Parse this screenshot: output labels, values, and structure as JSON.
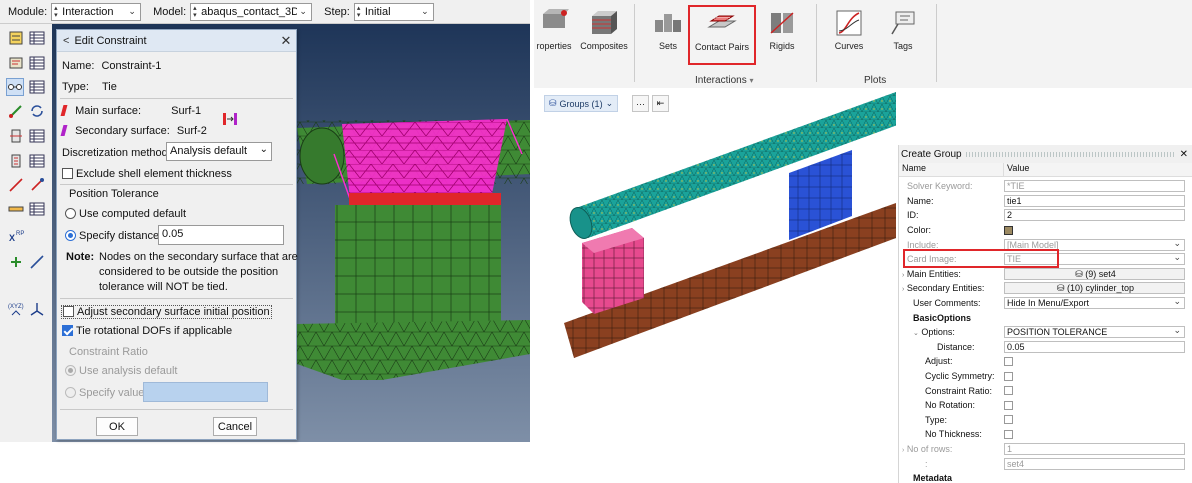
{
  "abaqus": {
    "module_label": "Module:",
    "module_value": "Interaction",
    "model_label": "Model:",
    "model_value": "abaqus_contact_3D",
    "step_label": "Step:",
    "step_value": "Initial"
  },
  "dialog": {
    "title": "Edit Constraint",
    "name_label": "Name:",
    "name_value": "Constraint-1",
    "type_label": "Type:",
    "type_value": "Tie",
    "main_surface_label": "Main surface:",
    "main_surface_value": "Surf-1",
    "secondary_surface_label": "Secondary surface:",
    "secondary_surface_value": "Surf-2",
    "discretization_label": "Discretization method:",
    "discretization_value": "Analysis default",
    "exclude_shell_label": "Exclude shell element thickness",
    "exclude_shell_checked": false,
    "position_tolerance_title": "Position Tolerance",
    "use_computed_default_label": "Use computed default",
    "specify_distance_label": "Specify distance:",
    "specify_distance_value": "0.05",
    "note_label": "Note:",
    "note_line1": "Nodes on the secondary surface that are",
    "note_line2": "considered to be outside the position",
    "note_line3": "tolerance will NOT be tied.",
    "adjust_label": "Adjust secondary surface initial position",
    "adjust_checked": false,
    "tie_rot_label": "Tie rotational DOFs if applicable",
    "tie_rot_checked": true,
    "constraint_ratio_title": "Constraint Ratio",
    "use_analysis_default_label": "Use analysis default",
    "specify_value_label": "Specify value",
    "ok_label": "OK",
    "cancel_label": "Cancel"
  },
  "hypermesh": {
    "ribbon": {
      "items": [
        "roperties",
        "Composites",
        "Sets",
        "Contact Pairs",
        "Rigids",
        "Curves",
        "Tags"
      ],
      "section_interactions": "Interactions",
      "section_plots": "Plots"
    },
    "groups_label": "Groups (1)",
    "create_group": {
      "title": "Create Group",
      "col_name": "Name",
      "col_value": "Value",
      "rows": [
        {
          "name": "Solver Keyword:",
          "value": "*TIE"
        },
        {
          "name": "Name:",
          "value": "tie1"
        },
        {
          "name": "ID:",
          "value": "2"
        },
        {
          "name": "Color:",
          "value": ""
        },
        {
          "name": "Include:",
          "value": "[Main Model]"
        },
        {
          "name": "Card Image:",
          "value": "TIE"
        },
        {
          "name": "Main Entities:",
          "value": "(9) set4"
        },
        {
          "name": "Secondary Entities:",
          "value": "(10) cylinder_top"
        },
        {
          "name": "User Comments:",
          "value": "Hide In Menu/Export"
        },
        {
          "name": "BasicOptions",
          "value": ""
        },
        {
          "name": "Options:",
          "value": "POSITION TOLERANCE"
        },
        {
          "name": "Distance:",
          "value": "0.05"
        },
        {
          "name": "Adjust:",
          "value": ""
        },
        {
          "name": "Cyclic Symmetry:",
          "value": ""
        },
        {
          "name": "Constraint Ratio:",
          "value": ""
        },
        {
          "name": "No Rotation:",
          "value": ""
        },
        {
          "name": "Type:",
          "value": ""
        },
        {
          "name": "No Thickness:",
          "value": ""
        },
        {
          "name": "No of rows:",
          "value": "1"
        },
        {
          "name": ":",
          "value": "set4"
        },
        {
          "name": "Metadata",
          "value": ""
        }
      ]
    }
  },
  "colors": {
    "highlight_red": "#e0262a",
    "green_mesh": "#3f8a35",
    "magenta": "#ff2bd2",
    "teal": "#1aa39a",
    "brown": "#8a4020",
    "blue_block": "#2a52d6",
    "pink_block": "#e64a8e"
  }
}
